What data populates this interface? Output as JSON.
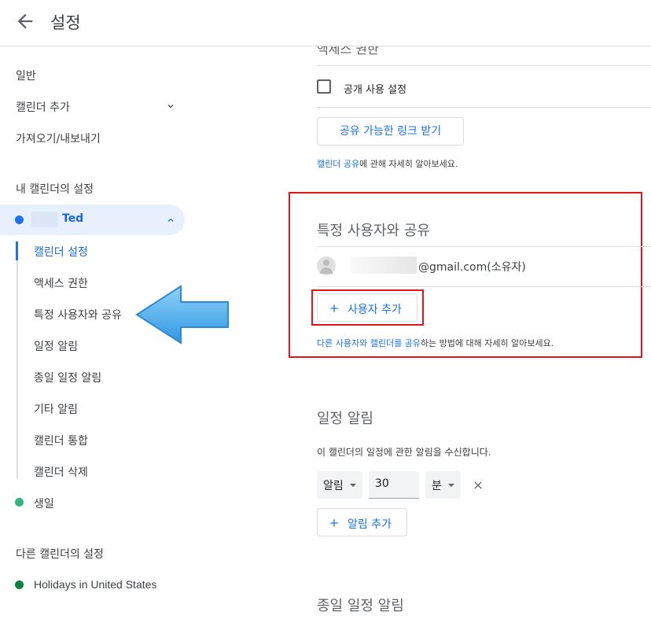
{
  "header": {
    "title": "설정",
    "back_icon": "arrow-back-icon"
  },
  "sidebar": {
    "general": "일반",
    "add_calendar": "캘린더 추가",
    "import_export": "가져오기/내보내기",
    "my_calendars_title": "내 캘린더의 설정",
    "my_calendar": {
      "name": "Ted",
      "color": "#1a73e8"
    },
    "sub_items": [
      "캘린더 설정",
      "액세스 권한",
      "특정 사용자와 공유",
      "일정 알림",
      "종일 일정 알림",
      "기타 알림",
      "캘린더 통합",
      "캘린더 삭제"
    ],
    "birthday": {
      "name": "생일",
      "color": "#33b679"
    },
    "other_calendars_title": "다른 캘린더의 설정",
    "other_calendar": {
      "name": "Holidays in United States",
      "color": "#0b8043"
    }
  },
  "main": {
    "cut_heading": "액세스 권한",
    "public_label": "공개 사용 설정",
    "share_link_button": "공유 가능한 링크 받기",
    "calendar_share_link": "캘린더 공유",
    "calendar_share_suffix": "에 관해 자세히 알아보세요.",
    "share_title": "특정 사용자와 공유",
    "owner_email": "@gmail.com(소유자)",
    "add_user_button": "사용자 추가",
    "help_link_1": "다른 사용자와 캘린더를 공유",
    "help_suffix_1": "하는 방법에 대해 자세히 알아보세요.",
    "event_alert_title": "일정 알림",
    "event_alert_desc": "이 캘린더의 일정에 관한 알림을 수신합니다.",
    "alert_type": "알림",
    "alert_value": "30",
    "alert_unit": "분",
    "add_alert_button": "알림 추가",
    "allday_title": "종일 일정 알림"
  },
  "colors": {
    "accent": "#1a73e8",
    "highlight": "#e5141b",
    "arrow": "#45a9e8"
  }
}
